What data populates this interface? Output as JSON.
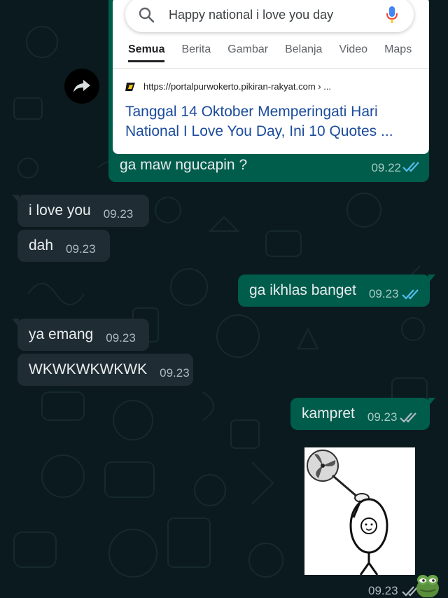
{
  "link_preview": {
    "search_query": "Happy national i love you day",
    "tabs": [
      "Semua",
      "Berita",
      "Gambar",
      "Belanja",
      "Video",
      "Maps"
    ],
    "result_url": "https://portalpurwokerto.pikiran-rakyat.com › ...",
    "result_title": "Tanggal 14 Oktober Memperingati Hari National I Love You Day, Ini 10 Quotes ...",
    "caption": "ga maw ngucapin ?",
    "time": "09.22"
  },
  "messages": [
    {
      "text": "i love you",
      "time": "09.23"
    },
    {
      "text": "dah",
      "time": "09.23"
    },
    {
      "text": "ga ikhlas banget",
      "time": "09.23"
    },
    {
      "text": "ya emang",
      "time": "09.23"
    },
    {
      "text": "WKWKWKWKWK",
      "time": "09.23"
    },
    {
      "text": "kampret",
      "time": "09.23"
    }
  ],
  "sticker": {
    "time": "09.23"
  },
  "colors": {
    "background": "#0b1a1e",
    "incoming_bubble": "#1f2c33",
    "outgoing_bubble": "#005c4b",
    "read_ticks": "#53bdeb",
    "delivered_ticks": "#aebac1",
    "link_blue": "#1a4b9c"
  }
}
